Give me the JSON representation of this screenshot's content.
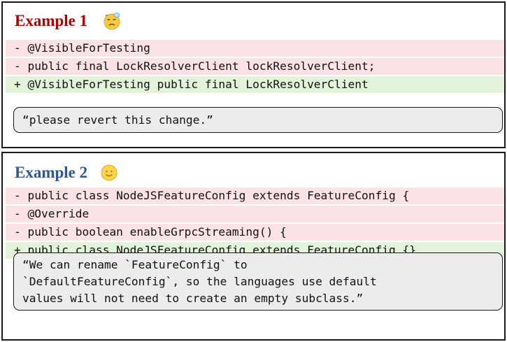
{
  "examples": [
    {
      "title": "Example 1",
      "title_color": "#b00000",
      "emoji_icon": "sleepy-face",
      "diff_lines": [
        {
          "type": "removed",
          "text": "- @VisibleForTesting"
        },
        {
          "type": "removed",
          "text": "- public final LockResolverClient lockResolverClient;"
        },
        {
          "type": "added",
          "text": "+ @VisibleForTesting public final LockResolverClient"
        }
      ],
      "comment": "“please revert this change.”"
    },
    {
      "title": "Example 2",
      "title_color": "#2e5597",
      "emoji_icon": "smiling-face",
      "diff_lines": [
        {
          "type": "removed",
          "text": "- public class NodeJSFeatureConfig extends FeatureConfig {"
        },
        {
          "type": "removed",
          "text": "- @Override"
        },
        {
          "type": "removed",
          "text": "- public boolean enableGrpcStreaming() {"
        },
        {
          "type": "added",
          "text": "+ public class NodeJSFeatureConfig extends FeatureConfig {}"
        }
      ],
      "comment_lines": [
        "“We can rename `FeatureConfig` to",
        "`DefaultFeatureConfig`, so the languages use default",
        "values will not need to create an empty subclass.”"
      ]
    }
  ]
}
